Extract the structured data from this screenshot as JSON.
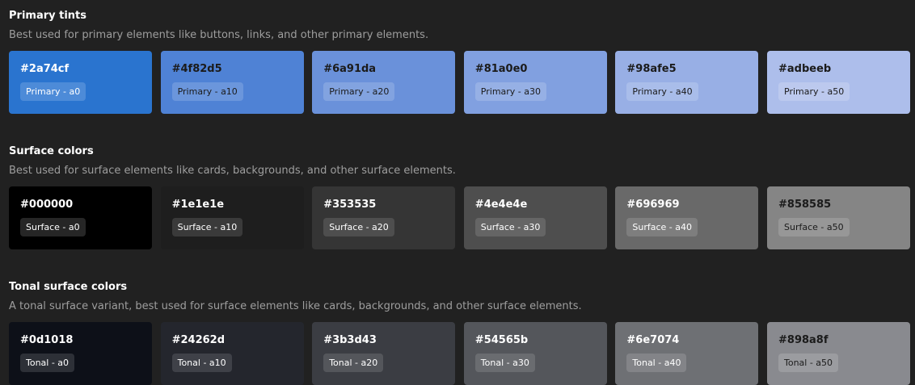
{
  "sections": [
    {
      "title": "Primary tints",
      "description": "Best used for primary elements like buttons, links, and other primary elements.",
      "swatches": [
        {
          "hex": "#2a74cf",
          "label": "Primary - a0",
          "color": "#2a74cf",
          "text_color": "#ffffff",
          "chip_bg": "#4d8bd8",
          "chip_text": "#ffffff"
        },
        {
          "hex": "#4f82d5",
          "label": "Primary - a10",
          "color": "#4f82d5",
          "text_color": "#1b1b1b",
          "chip_bg": "#6b96dc",
          "chip_text": "#1b1b1b"
        },
        {
          "hex": "#6a91da",
          "label": "Primary - a20",
          "color": "#6a91da",
          "text_color": "#1b1b1b",
          "chip_bg": "#82a3e0",
          "chip_text": "#1b1b1b"
        },
        {
          "hex": "#81a0e0",
          "label": "Primary - a30",
          "color": "#81a0e0",
          "text_color": "#1b1b1b",
          "chip_bg": "#96b0e5",
          "chip_text": "#1b1b1b"
        },
        {
          "hex": "#98afe5",
          "label": "Primary - a40",
          "color": "#98afe5",
          "text_color": "#1b1b1b",
          "chip_bg": "#a9bdea",
          "chip_text": "#1b1b1b"
        },
        {
          "hex": "#adbeeb",
          "label": "Primary - a50",
          "color": "#adbeeb",
          "text_color": "#1b1b1b",
          "chip_bg": "#bcc9ee",
          "chip_text": "#1b1b1b"
        }
      ]
    },
    {
      "title": "Surface colors",
      "description": "Best used for surface elements like cards, backgrounds, and other surface elements.",
      "swatches": [
        {
          "hex": "#000000",
          "label": "Surface - a0",
          "color": "#000000",
          "text_color": "#ffffff",
          "chip_bg": "#262626",
          "chip_text": "#ffffff"
        },
        {
          "hex": "#1e1e1e",
          "label": "Surface - a10",
          "color": "#1e1e1e",
          "text_color": "#ffffff",
          "chip_bg": "#3a3a3a",
          "chip_text": "#ffffff"
        },
        {
          "hex": "#353535",
          "label": "Surface - a20",
          "color": "#353535",
          "text_color": "#ffffff",
          "chip_bg": "#4e4e4e",
          "chip_text": "#ffffff"
        },
        {
          "hex": "#4e4e4e",
          "label": "Surface - a30",
          "color": "#4e4e4e",
          "text_color": "#ffffff",
          "chip_bg": "#656565",
          "chip_text": "#ffffff"
        },
        {
          "hex": "#696969",
          "label": "Surface - a40",
          "color": "#696969",
          "text_color": "#ffffff",
          "chip_bg": "#7e7e7e",
          "chip_text": "#ffffff"
        },
        {
          "hex": "#858585",
          "label": "Surface - a50",
          "color": "#858585",
          "text_color": "#1b1b1b",
          "chip_bg": "#979797",
          "chip_text": "#1b1b1b"
        }
      ]
    },
    {
      "title": "Tonal surface colors",
      "description": "A tonal surface variant, best used for surface elements like cards, backgrounds, and other surface elements.",
      "swatches": [
        {
          "hex": "#0d1018",
          "label": "Tonal - a0",
          "color": "#0d1018",
          "text_color": "#ffffff",
          "chip_bg": "#2d3037",
          "chip_text": "#ffffff"
        },
        {
          "hex": "#24262d",
          "label": "Tonal - a10",
          "color": "#24262d",
          "text_color": "#ffffff",
          "chip_bg": "#3f4148",
          "chip_text": "#ffffff"
        },
        {
          "hex": "#3b3d43",
          "label": "Tonal - a20",
          "color": "#3b3d43",
          "text_color": "#ffffff",
          "chip_bg": "#54565b",
          "chip_text": "#ffffff"
        },
        {
          "hex": "#54565b",
          "label": "Tonal - a30",
          "color": "#54565b",
          "text_color": "#ffffff",
          "chip_bg": "#6a6c70",
          "chip_text": "#ffffff"
        },
        {
          "hex": "#6e7074",
          "label": "Tonal - a40",
          "color": "#6e7074",
          "text_color": "#ffffff",
          "chip_bg": "#838488",
          "chip_text": "#ffffff"
        },
        {
          "hex": "#898a8f",
          "label": "Tonal - a50",
          "color": "#898a8f",
          "text_color": "#1b1b1b",
          "chip_bg": "#9b9ca0",
          "chip_text": "#1b1b1b"
        }
      ]
    }
  ]
}
